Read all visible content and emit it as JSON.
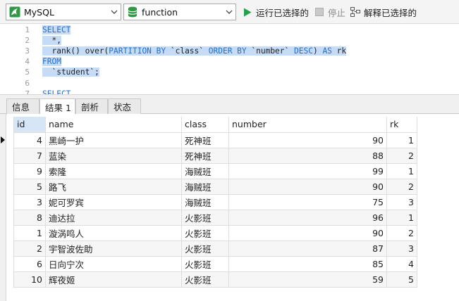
{
  "toolbar": {
    "connection": {
      "value": "MySQL",
      "icon": "mysql-dolphin-icon"
    },
    "database": {
      "value": "function",
      "icon": "database-icon"
    },
    "run_selected_label": "运行已选择的",
    "stop_label": "停止",
    "explain_selected_label": "解释已选择的"
  },
  "editor": {
    "line_numbers": [
      "1",
      "2",
      "3",
      "4",
      "5",
      "6",
      "7"
    ],
    "lines": [
      [
        {
          "t": "SELECT",
          "k": true
        }
      ],
      [
        {
          "t": "  *,",
          "k": false
        }
      ],
      [
        {
          "t": "  rank() over(",
          "k": false
        },
        {
          "t": "PARTITION BY",
          "k": true
        },
        {
          "t": " `class` ",
          "k": false
        },
        {
          "t": "ORDER BY",
          "k": true
        },
        {
          "t": " `number` ",
          "k": false
        },
        {
          "t": "DESC",
          "k": true
        },
        {
          "t": ") ",
          "k": false
        },
        {
          "t": "AS",
          "k": true
        },
        {
          "t": " rk",
          "k": false
        }
      ],
      [
        {
          "t": "FROM",
          "k": true
        }
      ],
      [
        {
          "t": "  `student`;",
          "k": false
        }
      ],
      [],
      [
        {
          "t": "SELECT",
          "k": true
        }
      ]
    ],
    "keyword_color": "#1f6fd1",
    "selection_color": "#c6dbf5"
  },
  "tabs": [
    {
      "label": "信息",
      "active": false
    },
    {
      "label": "结果 1",
      "active": true
    },
    {
      "label": "剖析",
      "active": false
    },
    {
      "label": "状态",
      "active": false
    }
  ],
  "result": {
    "columns": [
      "id",
      "name",
      "class",
      "number",
      "rk"
    ],
    "rows": [
      [
        "4",
        "黑崎一护",
        "死神班",
        "90",
        "1"
      ],
      [
        "7",
        "蓝染",
        "死神班",
        "88",
        "2"
      ],
      [
        "9",
        "索隆",
        "海贼班",
        "99",
        "1"
      ],
      [
        "5",
        "路飞",
        "海贼班",
        "90",
        "2"
      ],
      [
        "3",
        "妮可罗宾",
        "海贼班",
        "75",
        "3"
      ],
      [
        "8",
        "迪达拉",
        "火影班",
        "96",
        "1"
      ],
      [
        "1",
        "漩涡鸣人",
        "火影班",
        "90",
        "2"
      ],
      [
        "2",
        "宇智波佐助",
        "火影班",
        "87",
        "3"
      ],
      [
        "6",
        "日向宁次",
        "火影班",
        "85",
        "4"
      ],
      [
        "10",
        "辉夜姬",
        "火影班",
        "59",
        "5"
      ]
    ],
    "current_row": 0
  }
}
